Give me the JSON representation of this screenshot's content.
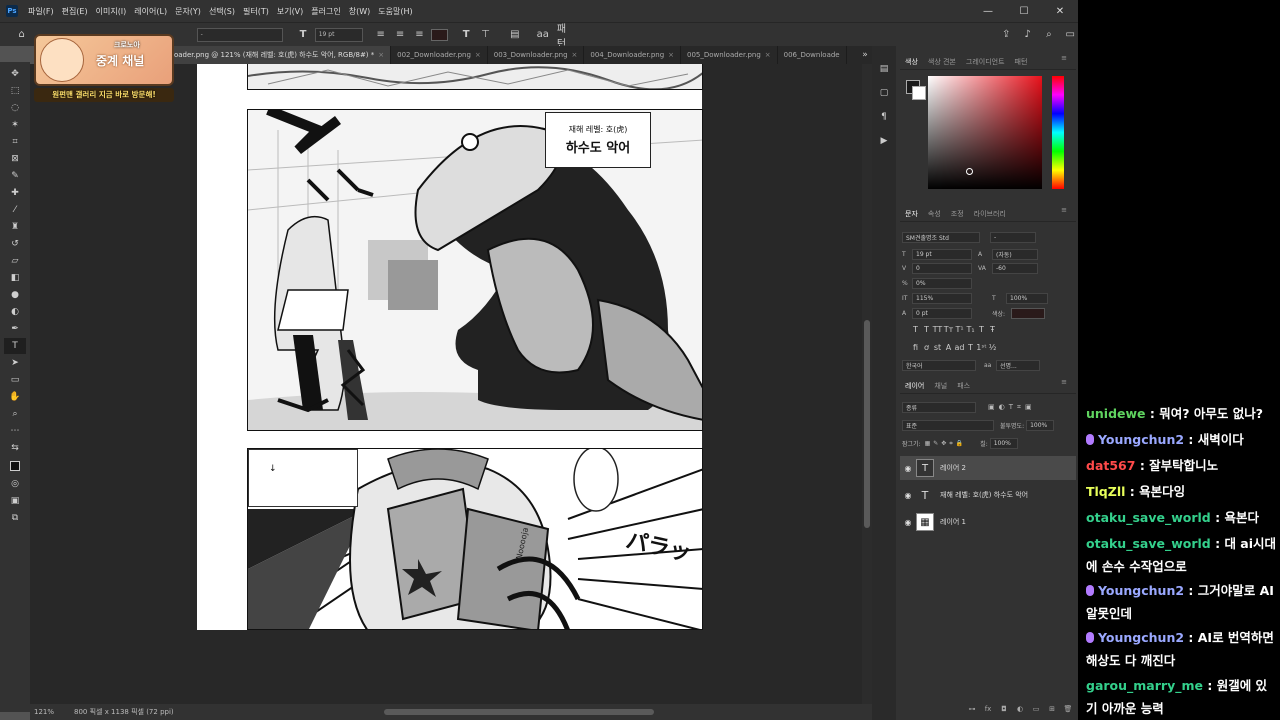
{
  "menubar": {
    "logo": "Ps",
    "items": [
      "파일(F)",
      "편집(E)",
      "이미지(I)",
      "레이어(L)",
      "문자(Y)",
      "선택(S)",
      "필터(T)",
      "보기(V)",
      "플러그인",
      "창(W)",
      "도움말(H)"
    ],
    "window_controls": [
      "—",
      "☐",
      "✕"
    ]
  },
  "optbar": {
    "font": "SM견출명조 Std",
    "style": "-",
    "size": "19 pt",
    "extra_a": "aa",
    "extra_b": "패턴"
  },
  "tabs": [
    {
      "label": "loader.png @ 121% (재해 레벨: 호(虎) 하수도 악어, RGB/8#) *",
      "active": true
    },
    {
      "label": "002_Downloader.png"
    },
    {
      "label": "003_Downloader.png"
    },
    {
      "label": "004_Downloader.png"
    },
    {
      "label": "005_Downloader.png"
    },
    {
      "label": "006_Downloade"
    }
  ],
  "manga": {
    "caption_line1": "재해 레벨: 호(虎)",
    "caption_line2": "하수도 악어",
    "sfx1": "ズ!",
    "sfx2": "パラッ",
    "book_text": "Nooooja",
    "textbox_mark": "↓"
  },
  "statusbar": {
    "zoom": "121%",
    "doc_size": "800 픽셀 x 1138 픽셀 (72 ppi)"
  },
  "color_panel": {
    "tabs": [
      "색상",
      "색상 견본",
      "그레이디언트",
      "패턴"
    ],
    "foreground": "#1a1a1a",
    "background": "#ffffff"
  },
  "char_panel": {
    "tabs": [
      "문자",
      "속성",
      "조정",
      "라이브러리"
    ],
    "font": "SM견출명조 Std",
    "style": "-",
    "size": "19 pt",
    "leading": "(자동)",
    "kerning": "0",
    "tracking": "-60",
    "tsume": "0%",
    "vscale": "115%",
    "hscale": "100%",
    "baseline": "0 pt",
    "color_label": "색상:",
    "color": "#2a1a1a",
    "language": "한국어",
    "aa_label": "aa",
    "aa_value": "선명..."
  },
  "layers_panel": {
    "tabs": [
      "레이어",
      "채널",
      "패스"
    ],
    "search": "종류",
    "blend": "표준",
    "opacity_label": "불투명도:",
    "opacity": "100%",
    "lock_label": "잠그기:",
    "fill_label": "칠:",
    "fill": "100%",
    "layers": [
      {
        "name": "레이어 2",
        "kind": "text",
        "selected": true
      },
      {
        "name": "재해 레벨: 호(虎) 하수도 악어",
        "kind": "text",
        "selected": false
      },
      {
        "name": "레이어 1",
        "kind": "image",
        "selected": false
      }
    ]
  },
  "badge": {
    "line1": "크로노아",
    "line2": "중계 채널",
    "line3": "원펀맨 갤러리 지금 바로 방문해!"
  },
  "chat": [
    {
      "user": "unidewe",
      "color": "#5fd35f",
      "mic": false,
      "text": ": 뭐여? 아무도 없나?"
    },
    {
      "user": "Youngchun2",
      "color": "#9aa8ff",
      "mic": true,
      "text": ": 새벽이다"
    },
    {
      "user": "dat567",
      "color": "#ff4a4a",
      "mic": false,
      "text": ": 잘부탁합니노"
    },
    {
      "user": "TlqZll",
      "color": "#e8ff5a",
      "mic": false,
      "text": ": 욕본다잉"
    },
    {
      "user": "otaku_save_world",
      "color": "#34d08c",
      "mic": false,
      "text": ": 욕본다"
    },
    {
      "user": "otaku_save_world",
      "color": "#34d08c",
      "mic": false,
      "text": ": 대 ai시대에 손수 수작업으로"
    },
    {
      "user": "Youngchun2",
      "color": "#9aa8ff",
      "mic": true,
      "text": ": 그거야말로 AI 알못인데"
    },
    {
      "user": "Youngchun2",
      "color": "#9aa8ff",
      "mic": true,
      "text": ": AI로 번역하면 해상도 다 깨진다"
    },
    {
      "user": "garou_marry_me",
      "color": "#34d08c",
      "mic": false,
      "text": ": 원갤에 있기 아까운 능력"
    }
  ]
}
